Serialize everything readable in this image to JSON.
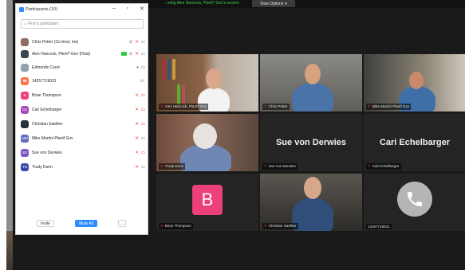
{
  "notice": "...wing Alex Hancock, Plent? Gov's screen",
  "view_options": "View Options",
  "panel": {
    "title": "Participants (10)",
    "search_placeholder": "Find a participant",
    "participants": [
      {
        "name": "Chris Potter (Co-host, me)",
        "initials": "",
        "color": "#8d6e63"
      },
      {
        "name": "Alex Hancock, Plent? Gov (Host)",
        "initials": "",
        "color": "#37474f"
      },
      {
        "name": "Edmonds Court",
        "initials": "",
        "color": "#90a4ae"
      },
      {
        "name": "14257719031",
        "initials": "",
        "color": "#ff7043"
      },
      {
        "name": "Brian Thompson",
        "initials": "B",
        "color": "#ec407a"
      },
      {
        "name": "Cari Echelbarger",
        "initials": "CE",
        "color": "#ab47bc"
      },
      {
        "name": "Christian Saether",
        "initials": "",
        "color": "#263238"
      },
      {
        "name": "Mike Martini Plantf Gov",
        "initials": "MM",
        "color": "#5c6bc0"
      },
      {
        "name": "Sue von Derwies",
        "initials": "SV",
        "color": "#7e57c2"
      },
      {
        "name": "Trudy Dunn",
        "initials": "TD",
        "color": "#3949ab"
      }
    ],
    "invite": "Invite",
    "mute_all": "Mute All",
    "more": "..."
  },
  "gallery": {
    "t1": "Alex Hancock, Plant? Gov",
    "t2": "Chris Potter",
    "t3": "Mike Martini Plantf Gov",
    "t4": "Trudy Dunn",
    "t5": "Sue von Derwies",
    "t5_big": "Sue von Derwies",
    "t6": "Cari Echelbarger",
    "t6_big": "Cari Echelbarger",
    "t7": "Brian Thompson",
    "t7_avatar": "B",
    "t8": "Christian Saether",
    "t9": "14257719031"
  }
}
